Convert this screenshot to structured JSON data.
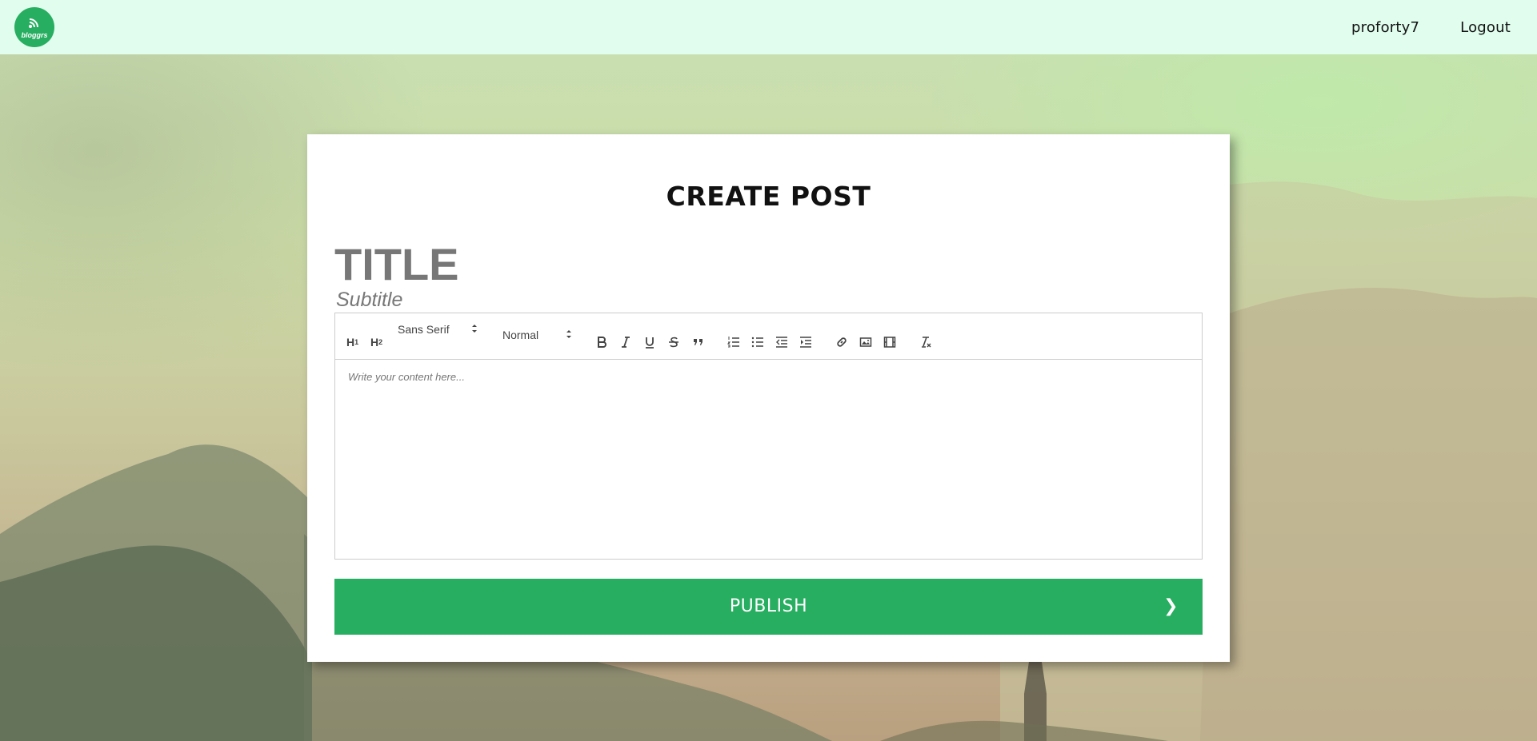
{
  "header": {
    "logo_text": "bloggrs",
    "username": "proforty7",
    "logout_label": "Logout"
  },
  "card": {
    "heading": "CREATE POST",
    "title_placeholder": "TITLE",
    "subtitle_placeholder": "Subtitle",
    "toolbar": {
      "h1_label": "H1",
      "h2_label": "H2",
      "font_picker_value": "Sans Serif",
      "size_picker_value": "Normal",
      "icons": [
        "bold-icon",
        "italic-icon",
        "underline-icon",
        "strike-icon",
        "blockquote-icon",
        "ordered-list-icon",
        "bullet-list-icon",
        "outdent-icon",
        "indent-icon",
        "link-icon",
        "image-icon",
        "video-icon",
        "clear-format-icon"
      ]
    },
    "content_placeholder": "Write your content here...",
    "publish_label": "PUBLISH",
    "publish_chevron": "❯"
  },
  "colors": {
    "brand_green": "#27ae60",
    "nav_background": "#e1fdee"
  }
}
